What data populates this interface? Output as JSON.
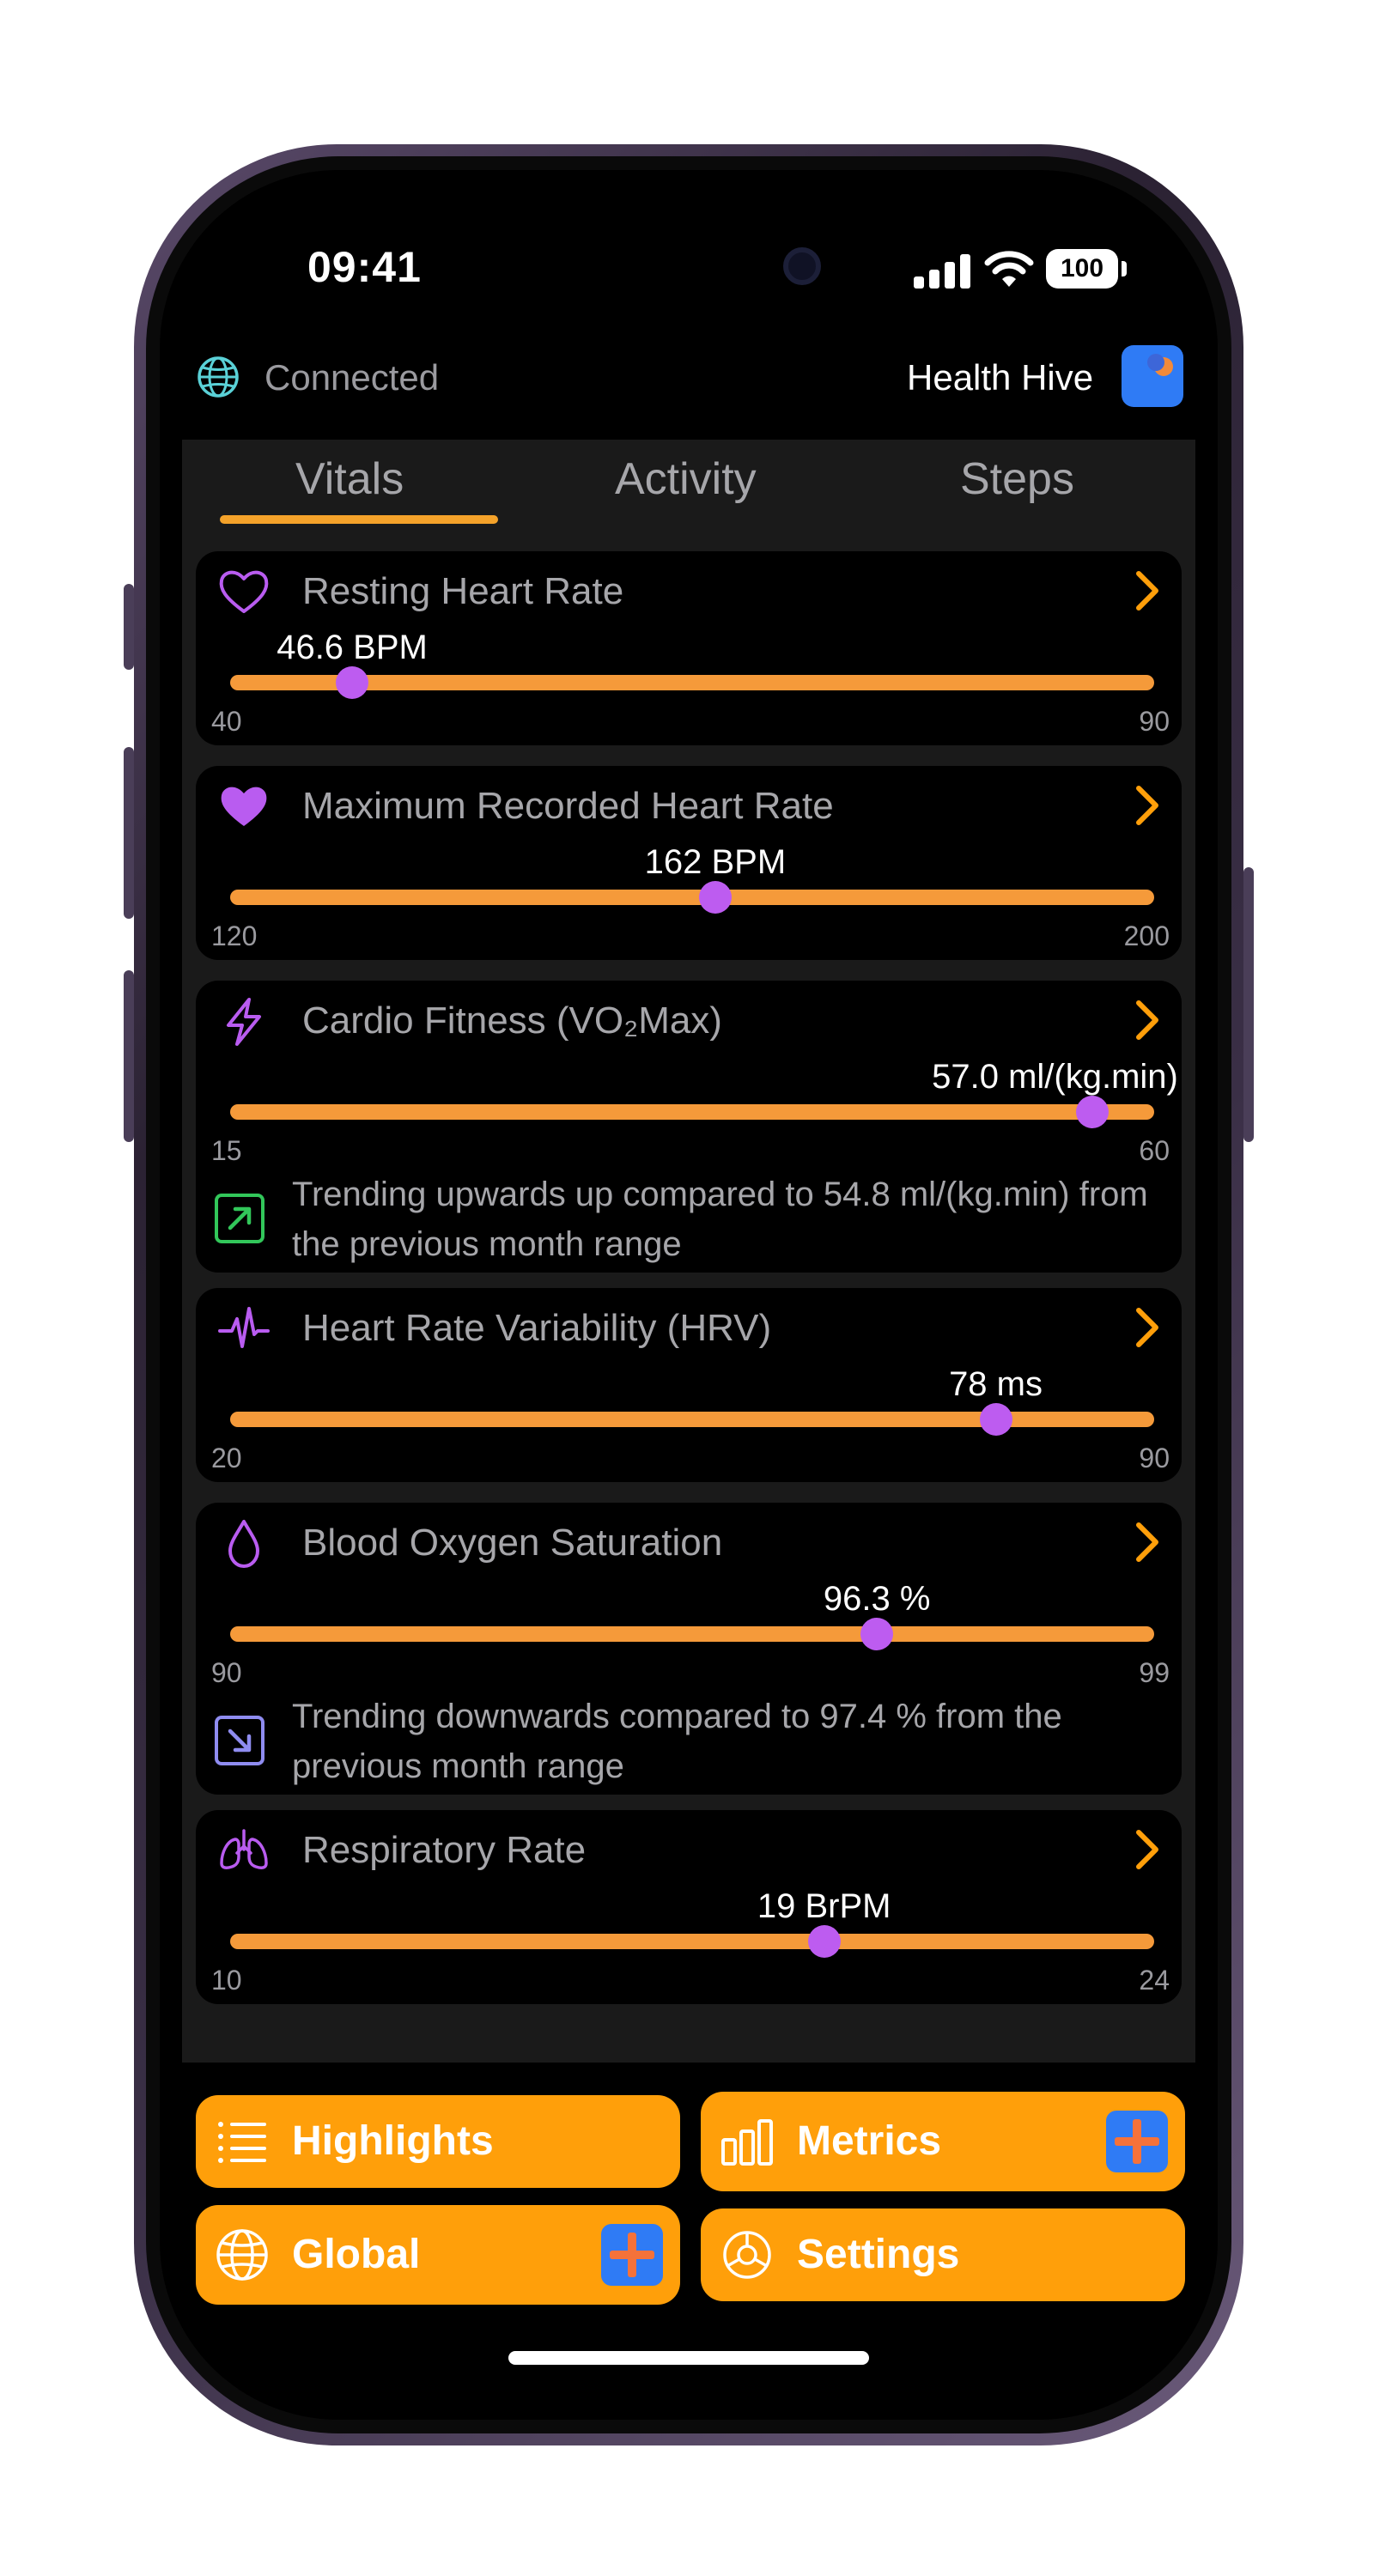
{
  "status_bar": {
    "time": "09:41",
    "battery": "100"
  },
  "header": {
    "connection_status": "Connected",
    "app_name": "Health Hive"
  },
  "tabs": [
    {
      "label": "Vitals",
      "selected": true
    },
    {
      "label": "Activity",
      "selected": false
    },
    {
      "label": "Steps",
      "selected": false
    }
  ],
  "metrics": [
    {
      "title": "Resting Heart Rate",
      "value": 46.6,
      "display": "46.6 BPM",
      "min": 40,
      "max": 90,
      "icon": "heart-outline-icon"
    },
    {
      "title": "Maximum Recorded Heart Rate",
      "value": 162,
      "display": "162 BPM",
      "min": 120,
      "max": 200,
      "icon": "heart-filled-icon"
    },
    {
      "title": "Cardio Fitness (VO₂Max)",
      "value": 57.0,
      "display": "57.0 ml/(kg.min)",
      "min": 15,
      "max": 60,
      "icon": "bolt-icon",
      "trend": "Trending upwards up compared to 54.8 ml/(kg.min) from the previous month range",
      "trend_icon": "arrow-up-right-icon"
    },
    {
      "title": "Heart Rate Variability (HRV)",
      "value": 78,
      "display": "78 ms",
      "min": 20,
      "max": 90,
      "icon": "waveform-icon"
    },
    {
      "title": "Blood Oxygen Saturation",
      "value": 96.3,
      "display": "96.3 %",
      "min": 90,
      "max": 99,
      "icon": "drop-icon",
      "trend": "Trending downwards compared to 97.4 % from the previous month range",
      "trend_icon": "arrow-down-right-icon"
    },
    {
      "title": "Respiratory Rate",
      "value": 19,
      "display": "19 BrPM",
      "min": 10,
      "max": 24,
      "icon": "lungs-icon"
    }
  ],
  "bottom_buttons": {
    "highlights": "Highlights",
    "metrics": "Metrics",
    "global": "Global",
    "settings": "Settings"
  },
  "colors": {
    "accent_orange": "#ff9f0a",
    "slider_track": "#f59a3a",
    "slider_knob": "#bd5cf0",
    "icon_purple": "#b95cf0",
    "trend_up": "#32c75a",
    "trend_down": "#8f8cf0",
    "logo_blue": "#2f7bf5"
  }
}
